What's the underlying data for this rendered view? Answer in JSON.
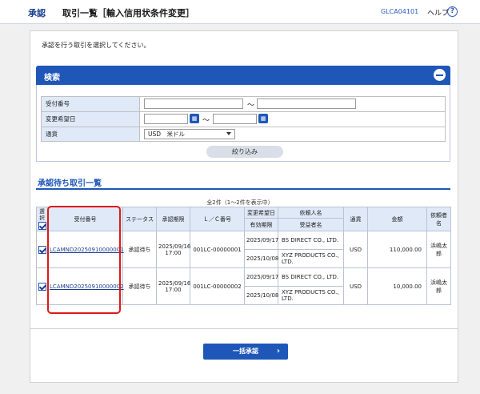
{
  "header": {
    "section": "承認",
    "title": "取引一覧［輸入信用状条件変更］",
    "screen_id": "GLCA04101",
    "help_label": "ヘルプ",
    "help_icon": "?"
  },
  "instruction": "承認を行う取引を選択してください。",
  "search": {
    "header_label": "検索",
    "fields": {
      "receipt_number_label": "受付番号",
      "receipt_from_value": "",
      "receipt_to_value": "",
      "change_date_label": "変更希望日",
      "change_from_value": "",
      "change_to_value": "",
      "currency_label": "通貨",
      "currency_value": "USD　米ドル"
    },
    "range_separator": "～",
    "filter_button": "絞り込み"
  },
  "list": {
    "title": "承認待ち取引一覧",
    "count_text": "全2件（1～2件を表示中）",
    "columns": {
      "select": "選択",
      "receipt_number": "受付番号",
      "status": "ステータス",
      "approval_deadline": "承認期限",
      "lc_number": "Ｌ／Ｃ番号",
      "change_date": "変更希望日",
      "expiry_date": "有効期限",
      "applicant": "依頼人名",
      "beneficiary": "受益者名",
      "currency": "通貨",
      "amount": "金額",
      "requester": "依頼者名"
    },
    "rows": [
      {
        "receipt_number": "LCAMND20250910000001",
        "status": "承認待ち",
        "deadline_date": "2025/09/16",
        "deadline_time": "17:00",
        "lc_number": "001LC-00000001",
        "change_date": "2025/09/17",
        "expiry_date": "2025/10/08",
        "applicant": "BS DIRECT CO., LTD.",
        "beneficiary": "XYZ PRODUCTS CO., LTD.",
        "currency": "USD",
        "amount": "110,000.00",
        "requester": "浜嶋太郎"
      },
      {
        "receipt_number": "LCAMND20250910000002",
        "status": "承認待ち",
        "deadline_date": "2025/09/16",
        "deadline_time": "17:00",
        "lc_number": "001LC-00000002",
        "change_date": "2025/09/17",
        "expiry_date": "2025/10/08",
        "applicant": "BS DIRECT CO., LTD.",
        "beneficiary": "XYZ PRODUCTS CO., LTD.",
        "currency": "USD",
        "amount": "10,000.00",
        "requester": "浜嶋太郎"
      }
    ]
  },
  "bulk_approve_button": "一括承認",
  "colors": {
    "primary": "#1e57b8",
    "highlight": "#e01818",
    "label_bg": "#dfe9f8"
  }
}
